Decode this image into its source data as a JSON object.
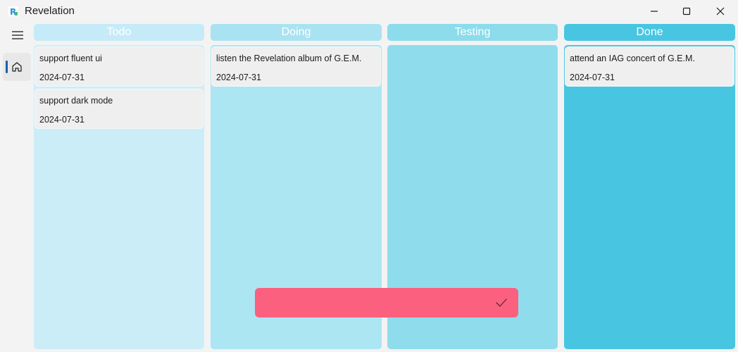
{
  "window": {
    "title": "Revelation",
    "controls": [
      "minimize-icon",
      "maximize-icon",
      "close-icon"
    ]
  },
  "nav": {
    "menu_icon": "hamburger-icon",
    "items": [
      {
        "icon": "home-icon",
        "selected": true
      }
    ]
  },
  "board": {
    "columns": [
      {
        "title": "Todo",
        "header_color": "#c6ebf8",
        "body_color": "#cbedf8",
        "cards": [
          {
            "title": "support fluent ui",
            "date": "2024-07-31"
          },
          {
            "title": "support dark mode",
            "date": "2024-07-31"
          }
        ]
      },
      {
        "title": "Doing",
        "header_color": "#a9e3f2",
        "body_color": "#ace6f3",
        "cards": [
          {
            "title": "listen the Revelation album of G.E.M.",
            "date": "2024-07-31"
          }
        ]
      },
      {
        "title": "Testing",
        "header_color": "#8cdceb",
        "body_color": "#8fddec",
        "cards": []
      },
      {
        "title": "Done",
        "header_color": "#48c6e1",
        "body_color": "#48c6e1",
        "cards": [
          {
            "title": "attend an IAG concert of G.E.M.",
            "date": "2024-07-31"
          }
        ]
      }
    ]
  },
  "toast": {
    "color": "#fb617f",
    "icon": "checkmark-icon"
  },
  "colors": {
    "accent": "#1a5fa8",
    "background": "#f3f3f3"
  }
}
